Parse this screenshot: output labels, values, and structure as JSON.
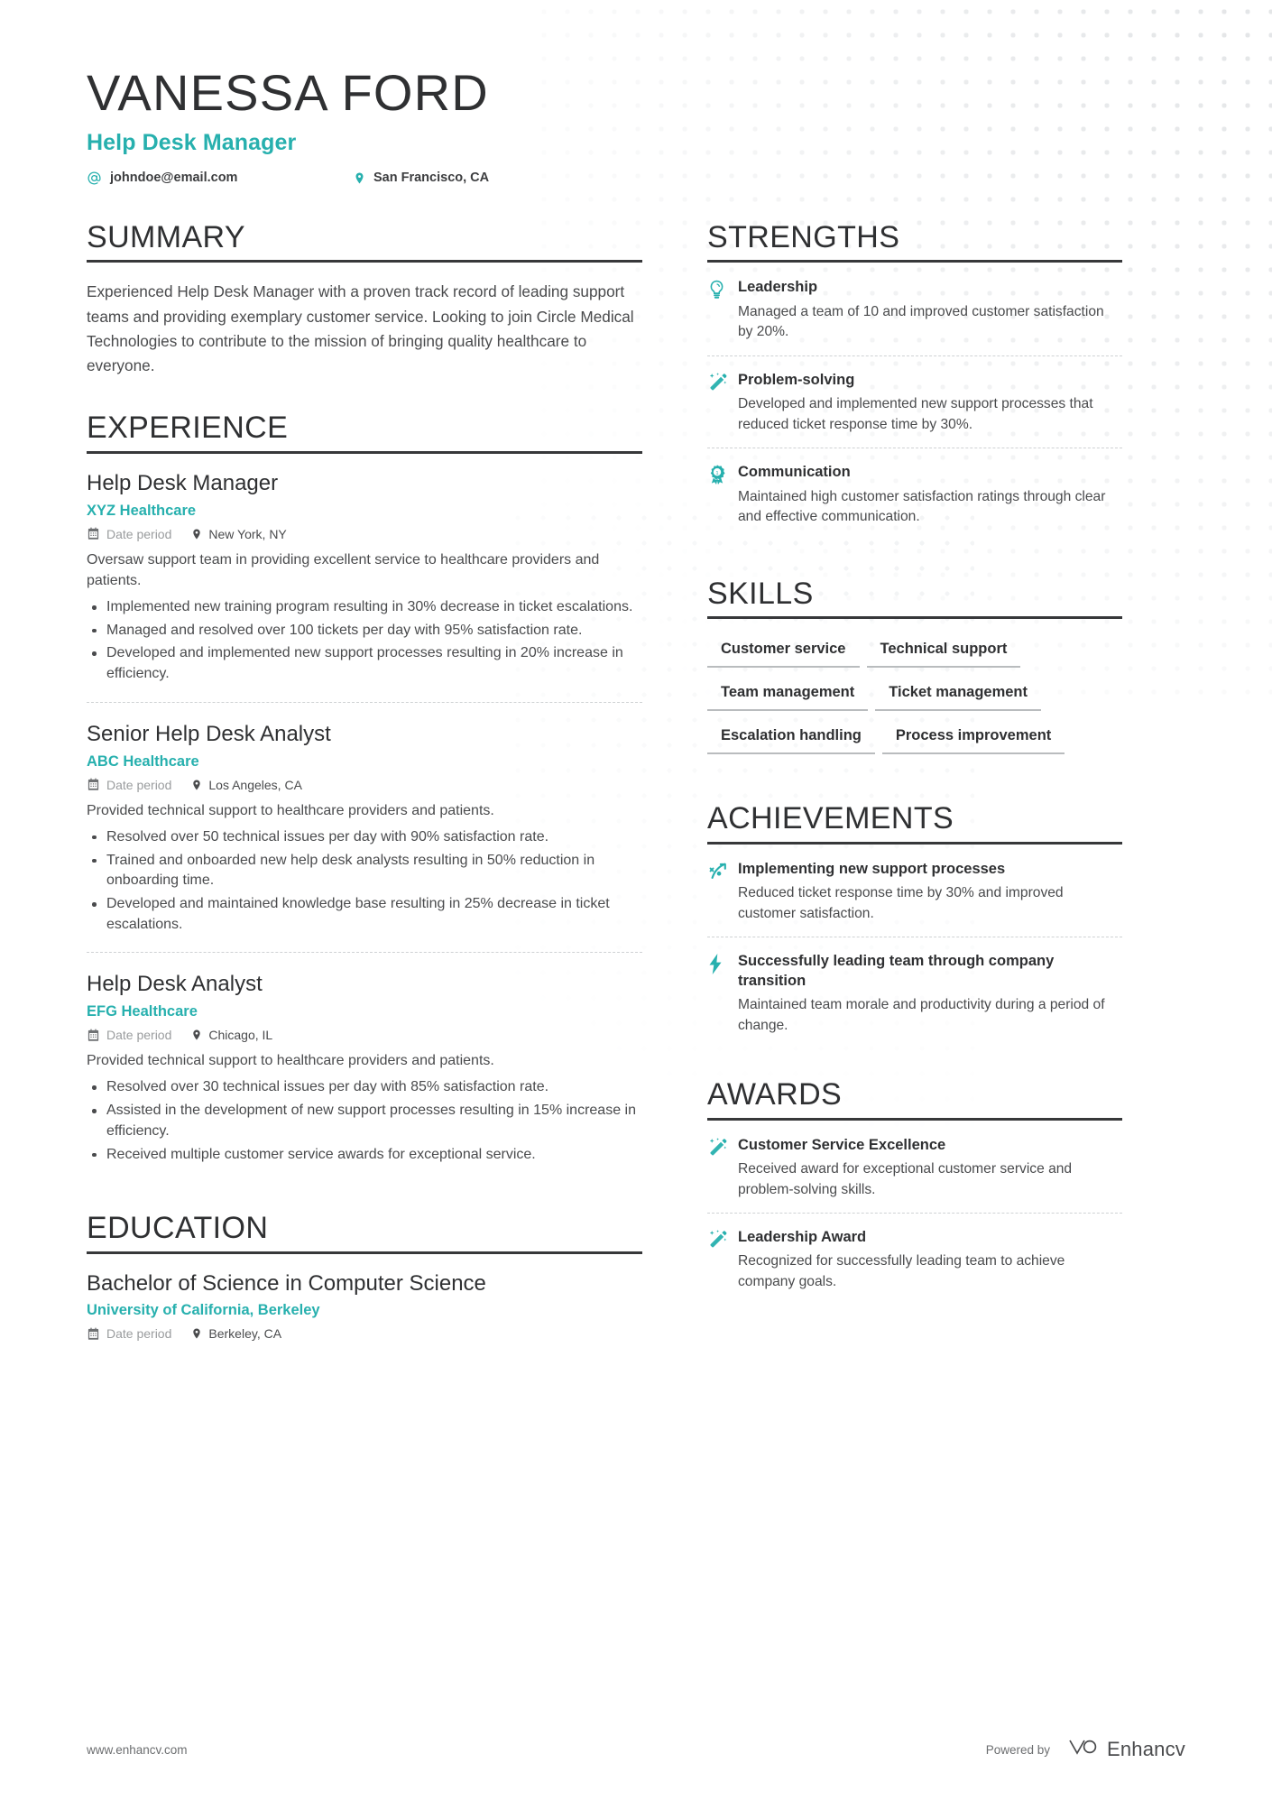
{
  "theme": {
    "accent": "#27b0ae",
    "text_dark": "#2f3032",
    "text_body": "#4a4b4d",
    "muted": "#9a9c9e"
  },
  "header": {
    "name": "VANESSA FORD",
    "job_title": "Help Desk Manager",
    "email": "johndoe@email.com",
    "location": "San Francisco, CA",
    "email_icon": "at-sign-icon",
    "location_icon": "map-pin-icon"
  },
  "sections": {
    "summary_title": "SUMMARY",
    "experience_title": "EXPERIENCE",
    "education_title": "EDUCATION",
    "strengths_title": "STRENGTHS",
    "skills_title": "SKILLS",
    "achievements_title": "ACHIEVEMENTS",
    "awards_title": "AWARDS"
  },
  "summary": {
    "text": "Experienced Help Desk Manager with a proven track record of leading support teams and providing exemplary customer service. Looking to join Circle Medical Technologies to contribute to the mission of bringing quality healthcare to everyone."
  },
  "experience": [
    {
      "role": "Help Desk Manager",
      "company": "XYZ Healthcare",
      "date": "Date period",
      "location": "New York, NY",
      "description": "Oversaw support team in providing excellent service to healthcare providers and patients.",
      "bullets": [
        "Implemented new training program resulting in 30% decrease in ticket escalations.",
        "Managed and resolved over 100 tickets per day with 95% satisfaction rate.",
        "Developed and implemented new support processes resulting in 20% increase in efficiency."
      ]
    },
    {
      "role": "Senior Help Desk Analyst",
      "company": "ABC Healthcare",
      "date": "Date period",
      "location": "Los Angeles, CA",
      "description": "Provided technical support to healthcare providers and patients.",
      "bullets": [
        "Resolved over 50 technical issues per day with 90% satisfaction rate.",
        "Trained and onboarded new help desk analysts resulting in 50% reduction in onboarding time.",
        "Developed and maintained knowledge base resulting in 25% decrease in ticket escalations."
      ]
    },
    {
      "role": "Help Desk Analyst",
      "company": "EFG Healthcare",
      "date": "Date period",
      "location": "Chicago, IL",
      "description": "Provided technical support to healthcare providers and patients.",
      "bullets": [
        "Resolved over 30 technical issues per day with 85% satisfaction rate.",
        "Assisted in the development of new support processes resulting in 15% increase in efficiency.",
        "Received multiple customer service awards for exceptional service."
      ]
    }
  ],
  "education": [
    {
      "degree": "Bachelor of Science in Computer Science",
      "school": "University of California, Berkeley",
      "date": "Date period",
      "location": "Berkeley, CA"
    }
  ],
  "strengths": [
    {
      "icon": "lightbulb-icon",
      "title": "Leadership",
      "description": "Managed a team of 10 and improved customer satisfaction by 20%."
    },
    {
      "icon": "magic-wand-icon",
      "title": "Problem-solving",
      "description": "Developed and implemented new support processes that reduced ticket response time by 30%."
    },
    {
      "icon": "award-ribbon-icon",
      "title": "Communication",
      "description": "Maintained high customer satisfaction ratings through clear and effective communication."
    }
  ],
  "skills": [
    "Customer service",
    "Technical support",
    "Team management",
    "Ticket management",
    "Escalation handling",
    "Process improvement"
  ],
  "achievements": [
    {
      "icon": "trending-arrow-icon",
      "title": "Implementing new support processes",
      "description": "Reduced ticket response time by 30% and improved customer satisfaction."
    },
    {
      "icon": "lightning-bolt-icon",
      "title": "Successfully leading team through company transition",
      "description": "Maintained team morale and productivity during a period of change."
    }
  ],
  "awards": [
    {
      "icon": "magic-wand-icon",
      "title": "Customer Service Excellence",
      "description": "Received award for exceptional customer service and problem-solving skills."
    },
    {
      "icon": "magic-wand-icon",
      "title": "Leadership Award",
      "description": "Recognized for successfully leading team to achieve company goals."
    }
  ],
  "footer": {
    "url": "www.enhancv.com",
    "powered_by": "Powered by",
    "brand": "Enhancv"
  },
  "date_icon": "calendar-icon",
  "pin_icon": "map-pin-icon"
}
